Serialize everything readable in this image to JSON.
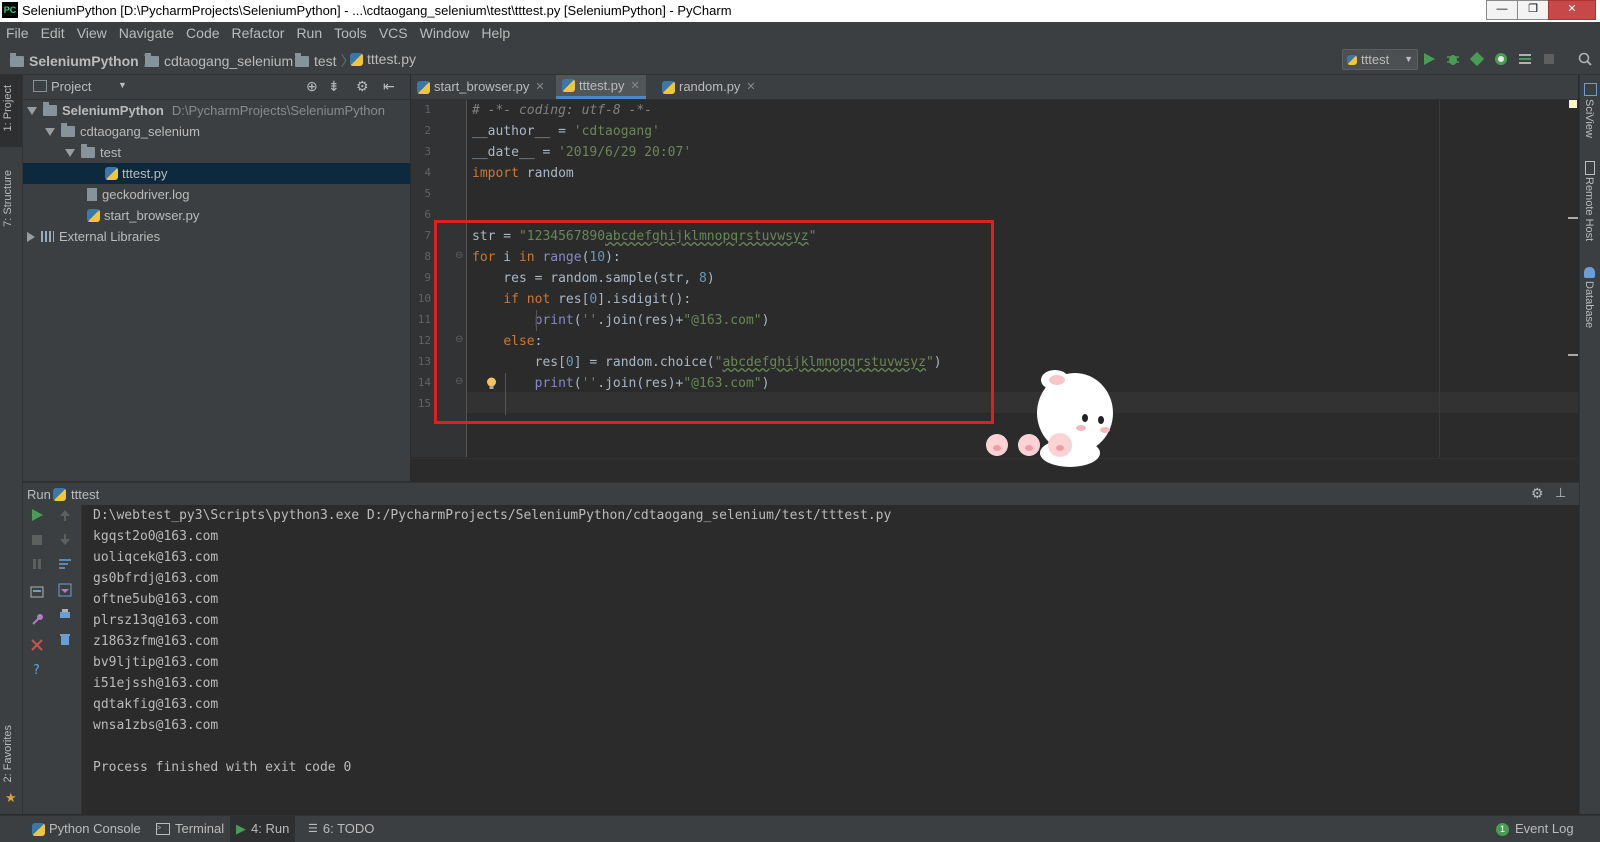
{
  "window": {
    "title": "SeleniumPython [D:\\PycharmProjects\\SeleniumPython] - ...\\cdtaogang_selenium\\test\\tttest.py [SeleniumPython] - PyCharm",
    "app_icon": "PC",
    "controls": [
      "—",
      "❐",
      "✕"
    ]
  },
  "menu": [
    "File",
    "Edit",
    "View",
    "Navigate",
    "Code",
    "Refactor",
    "Run",
    "Tools",
    "VCS",
    "Window",
    "Help"
  ],
  "breadcrumbs": [
    "SeleniumPython",
    "cdtaogang_selenium",
    "test",
    "tttest.py"
  ],
  "toolbar": {
    "run_config": "tttest"
  },
  "left_stripe": {
    "project_tab": "1: Project",
    "structure_tab": "7: Structure",
    "favorites_tab": "2: Favorites"
  },
  "right_stripe": {
    "sciview": "SciView",
    "remote_host": "Remote Host",
    "database": "Database"
  },
  "project_panel": {
    "title": "Project",
    "tree": [
      {
        "label": "SeleniumPython",
        "path": "D:\\PycharmProjects\\SeleniumPython"
      },
      {
        "label": "cdtaogang_selenium"
      },
      {
        "label": "test"
      },
      {
        "label": "tttest.py"
      },
      {
        "label": "geckodriver.log"
      },
      {
        "label": "start_browser.py"
      },
      {
        "label": "External Libraries"
      }
    ]
  },
  "editor": {
    "tabs": [
      "start_browser.py",
      "tttest.py",
      "random.py"
    ],
    "line_numbers": [
      "1",
      "2",
      "3",
      "4",
      "5",
      "6",
      "7",
      "8",
      "9",
      "10",
      "11",
      "12",
      "13",
      "14",
      "15"
    ],
    "code": {
      "l1": "# -*- coding: utf-8 -*-",
      "l2_a": "__author__ = ",
      "l2_b": "'cdtaogang'",
      "l3_a": "__date__ = ",
      "l3_b": "'2019/6/29 20:07'",
      "l4_a": "import",
      "l4_b": " random",
      "l7_a": "str = ",
      "l7_b": "\"1234567890",
      "l7_c": "abcdefghijklmnopqrstuvwsyz",
      "l7_d": "\"",
      "l8_a": "for",
      "l8_b": " i ",
      "l8_c": "in",
      "l8_d": " ",
      "l8_e": "range",
      "l8_f": "(",
      "l8_g": "10",
      "l8_h": "):",
      "l9_a": "    res = random.sample(str, ",
      "l9_b": "8",
      "l9_c": ")",
      "l10_a": "    ",
      "l10_b": "if not",
      "l10_c": " res[",
      "l10_d": "0",
      "l10_e": "].isdigit():",
      "l11_a": "        ",
      "l11_b": "print",
      "l11_c": "(",
      "l11_d": "''",
      "l11_e": ".join(res)+",
      "l11_f": "\"@163.com\"",
      "l11_g": ")",
      "l12_a": "    ",
      "l12_b": "else",
      "l12_c": ":",
      "l13_a": "        res[",
      "l13_b": "0",
      "l13_c": "] = random.choice(",
      "l13_d": "\"",
      "l13_e": "abcdefghijklmnopqrstuvwsyz",
      "l13_f": "\"",
      "l13_g": ")",
      "l14_a": "        ",
      "l14_b": "print",
      "l14_c": "(",
      "l14_d": "''",
      "l14_e": ".join(res)+",
      "l14_f": "\"@163.com\"",
      "l14_g": ")"
    }
  },
  "run_panel": {
    "label": "Run",
    "config": "tttest",
    "output": [
      "D:\\webtest_py3\\Scripts\\python3.exe D:/PycharmProjects/SeleniumPython/cdtaogang_selenium/test/tttest.py",
      "kgqst2o0@163.com",
      "uoliqcek@163.com",
      "gs0bfrdj@163.com",
      "oftne5ub@163.com",
      "plrsz13q@163.com",
      "z1863zfm@163.com",
      "bv9ljtip@163.com",
      "i51ejssh@163.com",
      "qdtakfig@163.com",
      "wnsa1zbs@163.com",
      "",
      "Process finished with exit code 0"
    ]
  },
  "bottom_bar": {
    "python_console": "Python Console",
    "terminal": "Terminal",
    "run": "4: Run",
    "todo": "6: TODO",
    "event_log": "Event Log"
  },
  "colors": {
    "highlight_box": "#e02020",
    "accent": "#4a88c7",
    "run_green": "#499c54"
  }
}
